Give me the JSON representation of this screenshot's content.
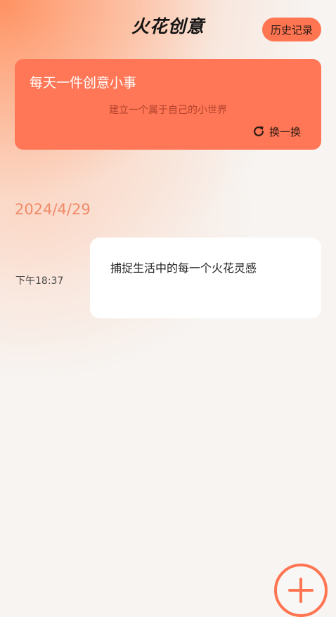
{
  "header": {
    "title": "火花创意",
    "history_label": "历史记录"
  },
  "banner": {
    "title": "每天一件创意小事",
    "subtitle": "建立一个属于自己的小世界",
    "refresh_label": "换一换",
    "refresh_icon": "refresh-icon"
  },
  "entries": {
    "date": "2024/4/29",
    "items": [
      {
        "time": "下午18:37",
        "text": "捕捉生活中的每一个火花灵感"
      }
    ]
  },
  "fab": {
    "icon": "plus-icon"
  },
  "colors": {
    "accent": "#ff7552",
    "card": "#ff7756",
    "date": "#f08a69",
    "background": "#f7f4f1"
  }
}
